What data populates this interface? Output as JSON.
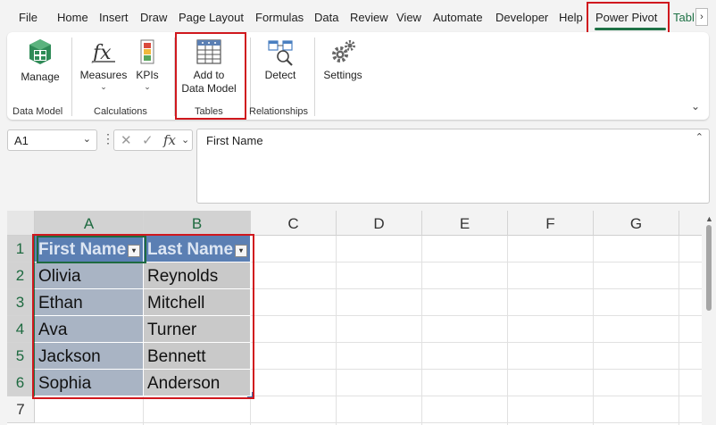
{
  "menu_tabs": [
    "File",
    "Home",
    "Insert",
    "Draw",
    "Page Layout",
    "Formulas",
    "Data",
    "Review",
    "View",
    "Automate",
    "Developer",
    "Help",
    "Power Pivot",
    "Tabl"
  ],
  "active_tab": "Power Pivot",
  "ribbon": {
    "buttons": {
      "manage": "Manage",
      "measures": "Measures",
      "kpis": "KPIs",
      "add_line1": "Add to",
      "add_line2": "Data Model",
      "detect": "Detect",
      "settings": "Settings"
    },
    "groups": {
      "data_model": "Data Model",
      "calculations": "Calculations",
      "tables": "Tables",
      "relationships": "Relationships"
    }
  },
  "formula_bar": {
    "cell_ref": "A1",
    "content": "First Name",
    "fx": "fx"
  },
  "sheet": {
    "columns": [
      "A",
      "B",
      "C",
      "D",
      "E",
      "F",
      "G"
    ],
    "rows": [
      "1",
      "2",
      "3",
      "4",
      "5",
      "6",
      "7"
    ],
    "table": {
      "headers": [
        "First Name",
        "Last Name"
      ],
      "rows": [
        [
          "Olivia",
          "Reynolds"
        ],
        [
          "Ethan",
          "Mitchell"
        ],
        [
          "Ava",
          "Turner"
        ],
        [
          "Jackson",
          "Bennett"
        ],
        [
          "Sophia",
          "Anderson"
        ]
      ]
    }
  },
  "colors": {
    "accent_green": "#1e7145",
    "highlight_red": "#d0181e",
    "table_header": "#5b7fb3",
    "table_band_col_a": "#a9b4c4",
    "table_band_col_b": "#c9c9c9"
  }
}
